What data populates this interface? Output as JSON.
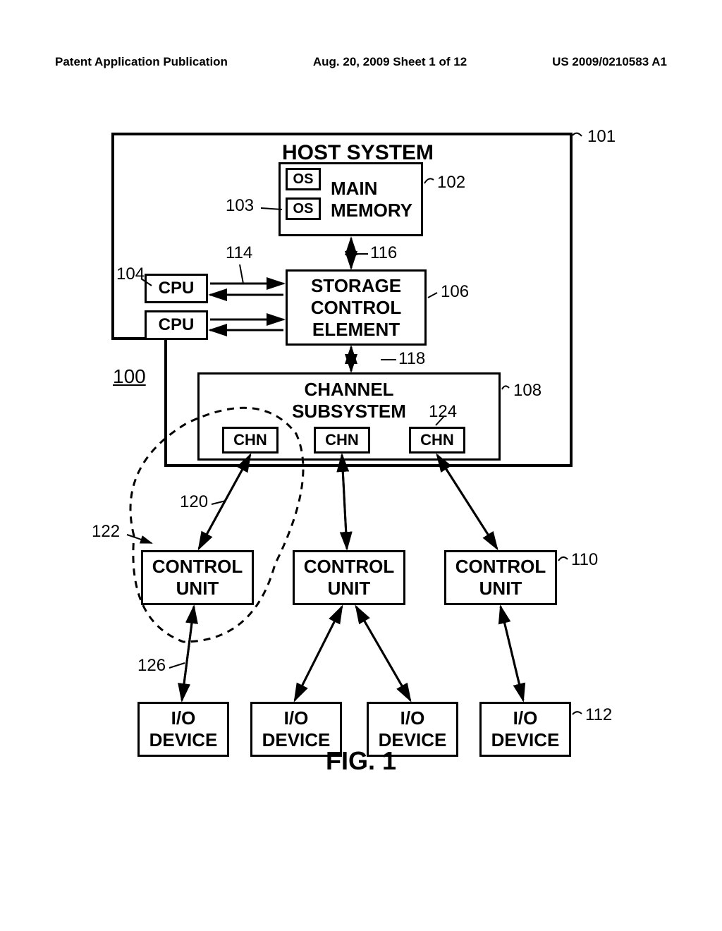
{
  "header": {
    "left": "Patent Application Publication",
    "center": "Aug. 20, 2009  Sheet 1 of 12",
    "right": "US 2009/0210583 A1"
  },
  "blocks": {
    "host_system": "HOST SYSTEM",
    "main_memory": "MAIN\nMEMORY",
    "os": "OS",
    "cpu": "CPU",
    "storage_control_element": "STORAGE\nCONTROL\nELEMENT",
    "channel_subsystem": "CHANNEL\nSUBSYSTEM",
    "chn": "CHN",
    "control_unit": "CONTROL\nUNIT",
    "io_device": "I/O\nDEVICE"
  },
  "refs": {
    "r100": "100",
    "r101": "101",
    "r102": "102",
    "r103": "103",
    "r104": "104",
    "r106": "106",
    "r108": "108",
    "r110": "110",
    "r112": "112",
    "r114": "114",
    "r116": "116",
    "r118": "118",
    "r120": "120",
    "r122": "122",
    "r124": "124",
    "r126": "126"
  },
  "figure_label": "FIG. 1"
}
